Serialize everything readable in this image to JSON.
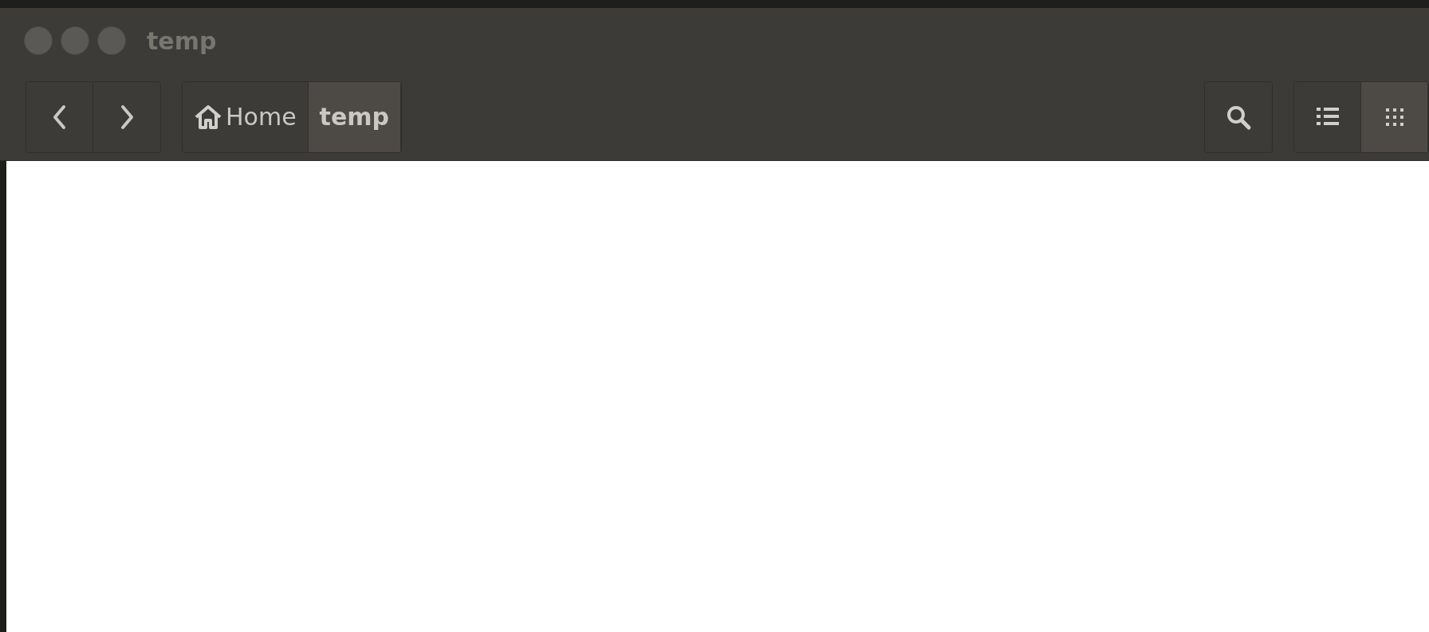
{
  "window": {
    "title": "temp"
  },
  "breadcrumbs": [
    {
      "kind": "home",
      "label": "Home",
      "selected": false
    },
    {
      "kind": "folder",
      "label": "temp",
      "selected": true
    }
  ],
  "view_modes": [
    {
      "kind": "list",
      "selected": false
    },
    {
      "kind": "grid",
      "selected": true
    }
  ]
}
